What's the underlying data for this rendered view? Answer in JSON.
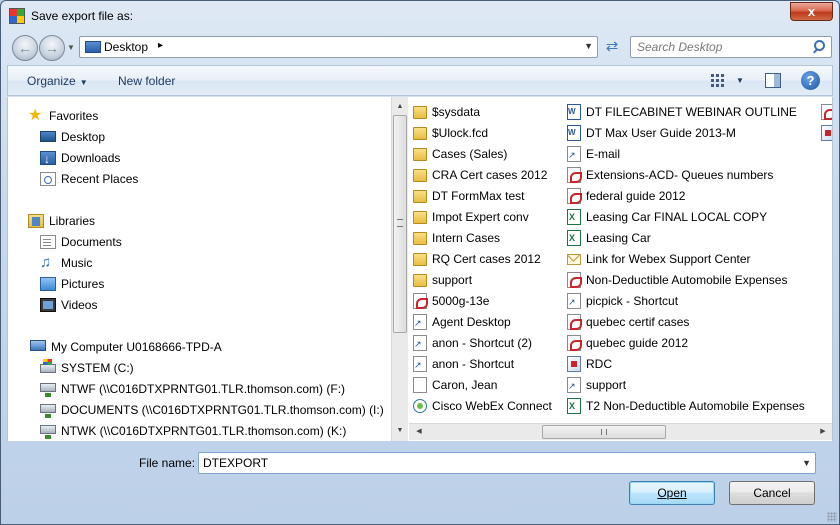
{
  "window": {
    "title": "Save export file as:",
    "close_label": "x"
  },
  "address_bar": {
    "location": "Desktop",
    "crumb_arrow": "▸"
  },
  "search": {
    "placeholder": "Search Desktop"
  },
  "command_bar": {
    "organize_label": "Organize",
    "new_folder_label": "New folder",
    "help_label": "?"
  },
  "nav_pane": {
    "favorites_label": "Favorites",
    "favorites": [
      {
        "label": "Desktop",
        "icon": "desktop-icon"
      },
      {
        "label": "Downloads",
        "icon": "downloads-icon"
      },
      {
        "label": "Recent Places",
        "icon": "recent-places-icon"
      }
    ],
    "libraries_label": "Libraries",
    "libraries": [
      {
        "label": "Documents",
        "icon": "documents-icon"
      },
      {
        "label": "Music",
        "icon": "music-icon"
      },
      {
        "label": "Pictures",
        "icon": "pictures-icon"
      },
      {
        "label": "Videos",
        "icon": "videos-icon"
      }
    ],
    "computer_label": "My Computer U0168666-TPD-A",
    "drives": [
      {
        "label": "SYSTEM (C:)",
        "icon": "system-drive-icon"
      },
      {
        "label": "NTWF (\\\\C016DTXPRNTG01.TLR.thomson.com) (F:)",
        "icon": "network-drive-icon"
      },
      {
        "label": "DOCUMENTS (\\\\C016DTXPRNTG01.TLR.thomson.com) (I:)",
        "icon": "network-drive-icon"
      },
      {
        "label": "NTWK (\\\\C016DTXPRNTG01.TLR.thomson.com) (K:)",
        "icon": "network-drive-icon"
      }
    ]
  },
  "files": {
    "column1": [
      {
        "label": "$sysdata",
        "type": "folder"
      },
      {
        "label": "$Ulock.fcd",
        "type": "folder"
      },
      {
        "label": "Cases (Sales)",
        "type": "folder"
      },
      {
        "label": "CRA Cert cases 2012",
        "type": "folder"
      },
      {
        "label": "DT FormMax test",
        "type": "folder"
      },
      {
        "label": "Impot Expert conv",
        "type": "folder"
      },
      {
        "label": "Intern Cases",
        "type": "folder"
      },
      {
        "label": "RQ Cert cases 2012",
        "type": "folder"
      },
      {
        "label": "support",
        "type": "folder"
      },
      {
        "label": "5000g-13e",
        "type": "pdf"
      },
      {
        "label": "Agent Desktop",
        "type": "shortcut"
      },
      {
        "label": "anon - Shortcut (2)",
        "type": "shortcut"
      },
      {
        "label": "anon - Shortcut",
        "type": "shortcut"
      },
      {
        "label": "Caron, Jean",
        "type": "doc"
      },
      {
        "label": "Cisco WebEx Connect",
        "type": "webex"
      }
    ],
    "column2": [
      {
        "label": "DT FILECABINET WEBINAR OUTLINE",
        "type": "word"
      },
      {
        "label": "DT Max User Guide 2013-M",
        "type": "word"
      },
      {
        "label": "E-mail",
        "type": "shortcut"
      },
      {
        "label": "Extensions-ACD- Queues numbers",
        "type": "pdf"
      },
      {
        "label": "federal guide 2012",
        "type": "pdf"
      },
      {
        "label": "Leasing Car FINAL LOCAL COPY",
        "type": "excel"
      },
      {
        "label": "Leasing Car",
        "type": "excel"
      },
      {
        "label": "Link for Webex Support Center",
        "type": "mail"
      },
      {
        "label": "Non-Deductible Automobile Expenses",
        "type": "pdf"
      },
      {
        "label": "picpick - Shortcut",
        "type": "shortcut"
      },
      {
        "label": "quebec certif cases",
        "type": "pdf"
      },
      {
        "label": "quebec guide 2012",
        "type": "pdf"
      },
      {
        "label": "RDC",
        "type": "app"
      },
      {
        "label": "support",
        "type": "shortcut"
      },
      {
        "label": "T2 Non-Deductible Automobile Expenses",
        "type": "excel"
      }
    ]
  },
  "bottom": {
    "filename_label": "File name:",
    "filename_value": "DTEXPORT",
    "open_label": "Open",
    "cancel_label": "Cancel"
  }
}
